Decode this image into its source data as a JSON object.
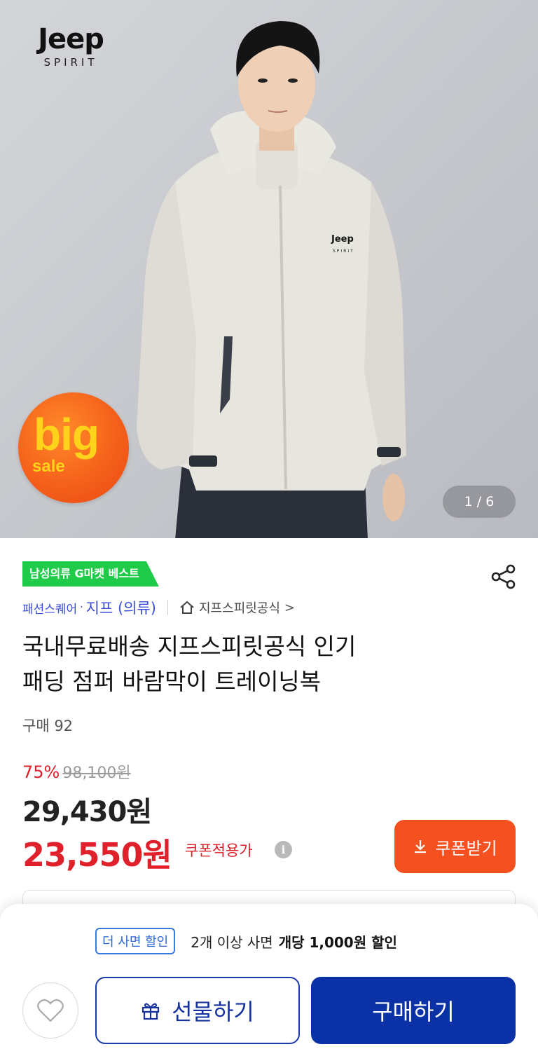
{
  "hero": {
    "brand_main": "Jeep",
    "brand_sub": "SPIRIT",
    "jacket_logo_main": "Jeep",
    "jacket_logo_sub": "SPIRIT",
    "big_sale_big": "big",
    "big_sale_sale": "sale",
    "pager": "1 / 6"
  },
  "badge": {
    "best": "남성의류 G마켓 베스트"
  },
  "breadcrumb": {
    "store": "패션스퀘어",
    "dot": "·",
    "brand": "지프 (의류)",
    "shop": "지프스피릿공식",
    "chevron": ">"
  },
  "product": {
    "title_line1": "국내무료배송 지프스피릿공식 인기",
    "title_line2": "패딩 점퍼 바람막이 트레이닝복",
    "buy_count": "구매 92",
    "discount_rate": "75%",
    "original_price": "98,100원",
    "sale_price": "29,430원",
    "coupon_price": "23,550원",
    "coupon_price_label": "쿠폰적용가",
    "info_symbol": "i",
    "coupon_button": "쿠폰받기"
  },
  "bottom_bar": {
    "promo_tag": "더 사면 할인",
    "promo_text": "2개 이상 사면",
    "promo_strong": "개당 1,000원 할인",
    "gift_button": "선물하기",
    "buy_button": "구매하기"
  },
  "colors": {
    "accent_red": "#e0202b",
    "coupon_orange": "#f5501f",
    "primary_blue": "#0b31a6",
    "best_green": "#1fcb49",
    "link_blue": "#3b4dd8"
  },
  "icons": [
    "share-icon",
    "home-icon",
    "info-icon",
    "download-icon",
    "heart-icon",
    "gift-icon"
  ]
}
